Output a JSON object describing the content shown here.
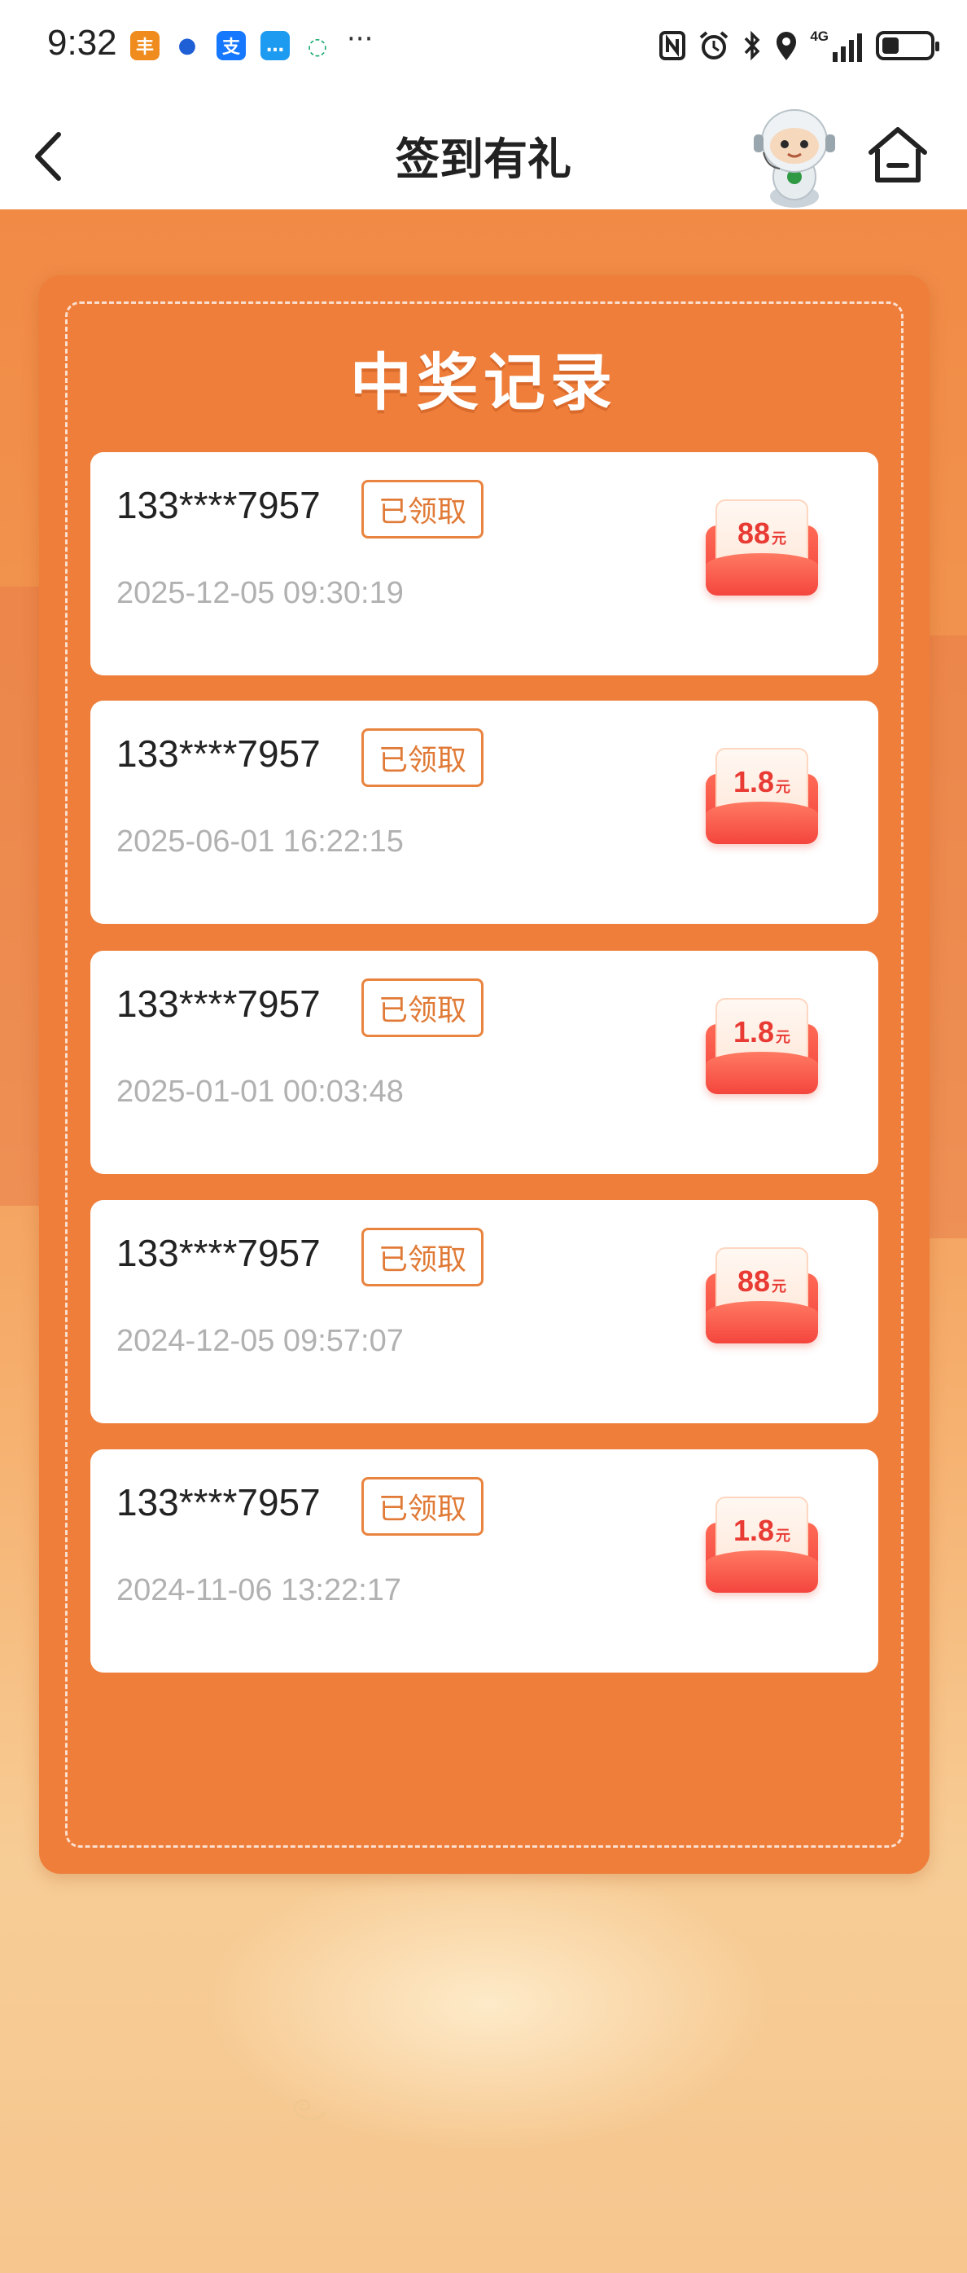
{
  "status_bar": {
    "time": "9:32",
    "apps": [
      {
        "icon": "shunfeng-app-icon",
        "glyph": "丰",
        "color": "#f08b1e"
      },
      {
        "icon": "blue-app-icon",
        "glyph": "●",
        "color": "#1f5fd6"
      },
      {
        "icon": "alipay-icon",
        "glyph": "支",
        "color": "#1677ff"
      },
      {
        "icon": "message-app-icon",
        "glyph": "…",
        "color": "#1d9bf0"
      },
      {
        "icon": "chat-bubble-icon",
        "glyph": "◌",
        "color": "#14a86b"
      }
    ],
    "more": "···",
    "network": "4G",
    "battery_level": 0.35
  },
  "nav": {
    "title": "签到有礼"
  },
  "panel": {
    "title": "中奖记录"
  },
  "records": [
    {
      "phone": "133****7957",
      "status": "已领取",
      "time": "2025-12-05 09:30:19",
      "amount": "88",
      "unit": "元"
    },
    {
      "phone": "133****7957",
      "status": "已领取",
      "time": "2025-06-01 16:22:15",
      "amount": "1.8",
      "unit": "元"
    },
    {
      "phone": "133****7957",
      "status": "已领取",
      "time": "2025-01-01 00:03:48",
      "amount": "1.8",
      "unit": "元"
    },
    {
      "phone": "133****7957",
      "status": "已领取",
      "time": "2024-12-05 09:57:07",
      "amount": "88",
      "unit": "元"
    },
    {
      "phone": "133****7957",
      "status": "已领取",
      "time": "2024-11-06 13:22:17",
      "amount": "1.8",
      "unit": "元"
    }
  ],
  "colors": {
    "panel": "#ee7e3a",
    "badge": "#e07a36",
    "coupon": "#f0413b"
  }
}
